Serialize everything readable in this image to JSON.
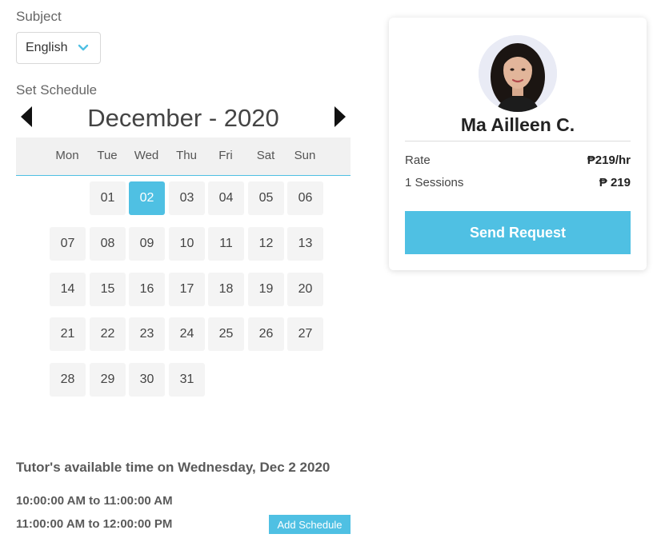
{
  "subject": {
    "label": "Subject",
    "selected": "English"
  },
  "schedule": {
    "label": "Set Schedule",
    "month_title": "December - 2020",
    "weekdays": [
      "Mon",
      "Tue",
      "Wed",
      "Thu",
      "Fri",
      "Sat",
      "Sun"
    ],
    "first_weekday_index": 1,
    "days": [
      "01",
      "02",
      "03",
      "04",
      "05",
      "06",
      "07",
      "08",
      "09",
      "10",
      "11",
      "12",
      "13",
      "14",
      "15",
      "16",
      "17",
      "18",
      "19",
      "20",
      "21",
      "22",
      "23",
      "24",
      "25",
      "26",
      "27",
      "28",
      "29",
      "30",
      "31"
    ],
    "selected_day": "02"
  },
  "availability": {
    "title": "Tutor's available time on Wednesday, Dec 2 2020",
    "slots": [
      "10:00:00 AM to 11:00:00 AM",
      "11:00:00 AM to 12:00:00 PM"
    ],
    "add_button": "Add Schedule"
  },
  "tutor_card": {
    "name": "Ma Ailleen C.",
    "rate_label": "Rate",
    "rate_value": "₱219/hr",
    "sessions_label": "1 Sessions",
    "sessions_value": "₱ 219",
    "button": "Send Request"
  },
  "colors": {
    "accent": "#4fc0e3",
    "day_bg": "#f4f4f4",
    "header_bg": "#f1f1f1"
  }
}
